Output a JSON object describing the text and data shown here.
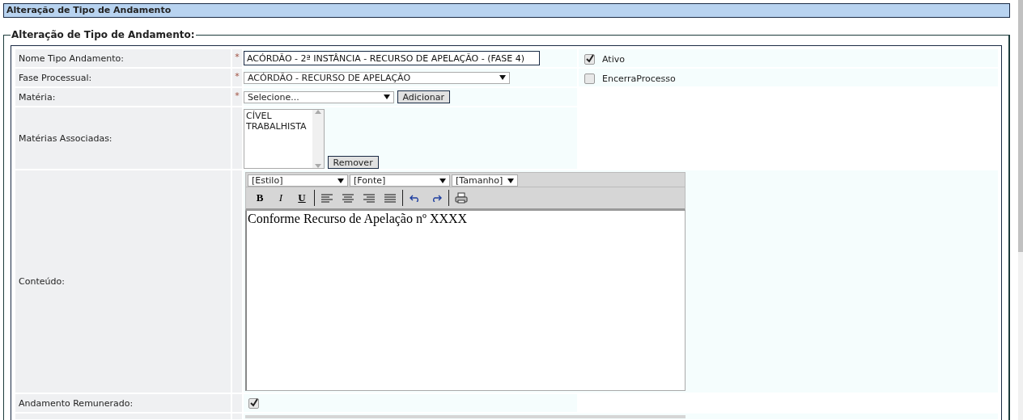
{
  "page_header": {
    "title": "Alteração de Tipo de Andamento"
  },
  "fieldset": {
    "legend": "Alteração de Tipo de Andamento:"
  },
  "fields": [
    {
      "kind": "text",
      "label": "Nome Tipo Andamento:",
      "marker": "*",
      "value": "ACÓRDÃO - 2ª INSTÂNCIA - RECURSO DE APELAÇÃO - (FASE 4)"
    },
    {
      "kind": "select",
      "label": "Fase Processual:",
      "marker": "*",
      "value": "ACÓRDÃO - RECURSO DE APELAÇÃO"
    },
    {
      "kind": "select_add",
      "label": "Matéria:",
      "marker": "*",
      "value": "Selecione...",
      "button": "Adicionar"
    },
    {
      "kind": "listbox",
      "label": "Matérias Associadas:",
      "items": [
        "CÍVEL",
        "TRABALHISTA"
      ],
      "button": "Remover"
    },
    {
      "kind": "editor",
      "label": "Conteúdo:",
      "dropdowns": [
        "[Estilo]",
        "[Fonte]",
        "[Tamanho]"
      ],
      "format_buttons": [
        "B",
        "I",
        "U"
      ],
      "text": "Conforme Recurso de Apelação nº XXXX"
    },
    {
      "kind": "checkbox",
      "label": "Andamento Remunerado:",
      "checked": true
    }
  ],
  "options": [
    {
      "label": "Ativo",
      "checked": true
    },
    {
      "label": "EncerraProcesso",
      "checked": false
    }
  ]
}
